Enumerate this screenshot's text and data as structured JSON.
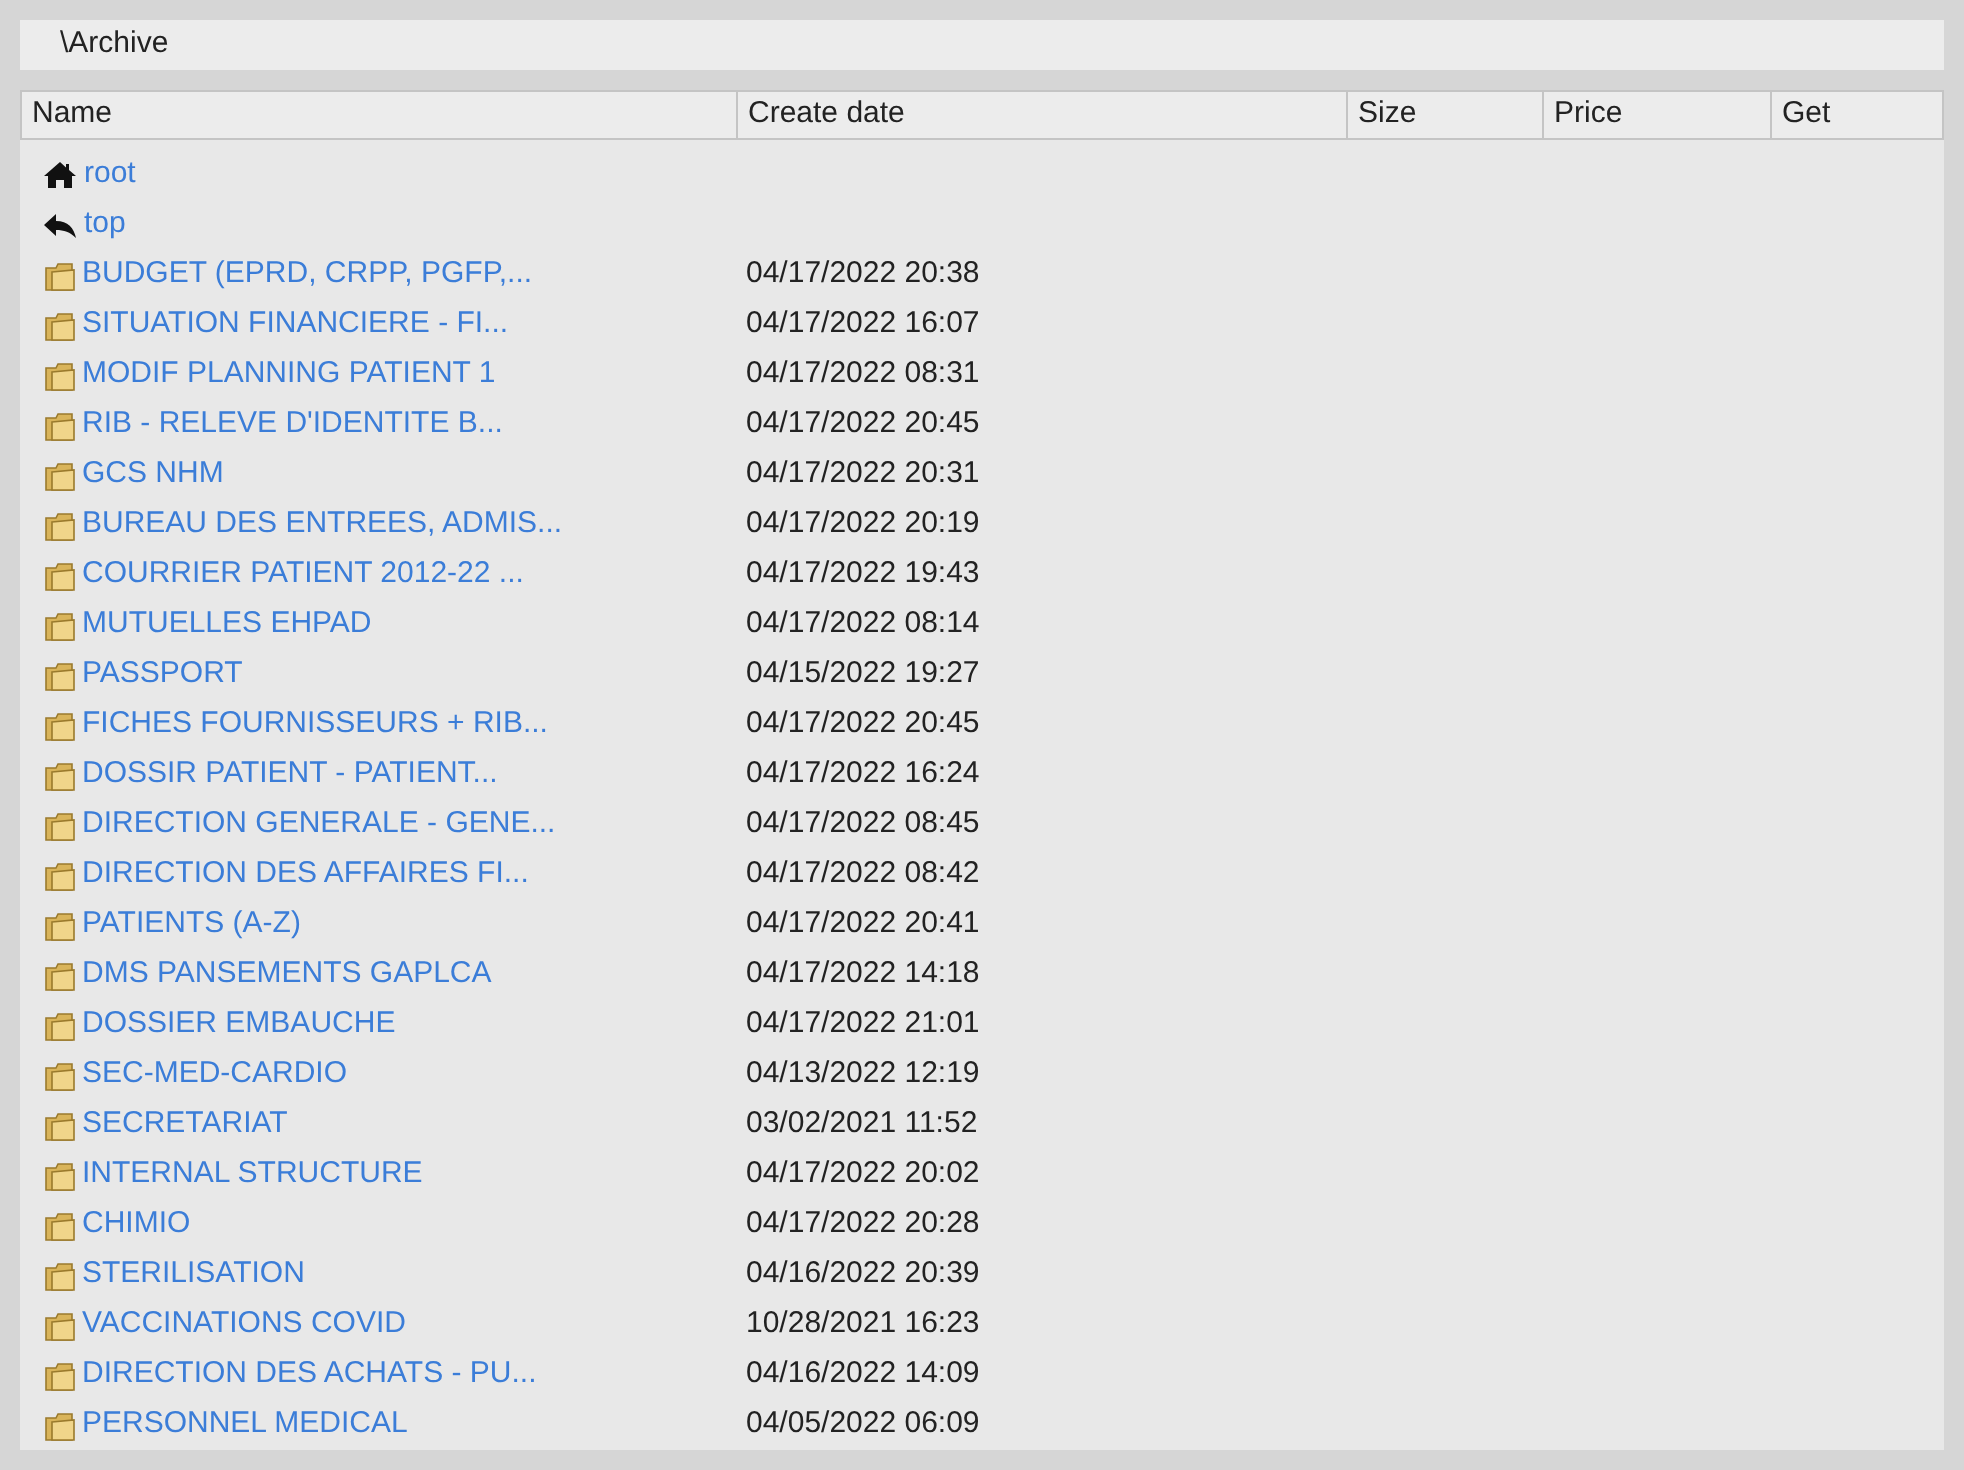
{
  "path": "\\Archive",
  "columns": [
    "Name",
    "Create date",
    "Size",
    "Price",
    "Get"
  ],
  "rows": [
    {
      "kind": "home",
      "name": "root"
    },
    {
      "kind": "up",
      "name": "top"
    },
    {
      "kind": "folder",
      "name": "BUDGET (EPRD, CRPP, PGFP,...",
      "date": "04/17/2022 20:38"
    },
    {
      "kind": "folder",
      "name": "SITUATION FINANCIERE - FI...",
      "date": "04/17/2022 16:07"
    },
    {
      "kind": "folder",
      "name": "MODIF PLANNING PATIENT 1",
      "date": "04/17/2022 08:31"
    },
    {
      "kind": "folder",
      "name": "RIB - RELEVE D'IDENTITE B...",
      "date": "04/17/2022 20:45"
    },
    {
      "kind": "folder",
      "name": "GCS NHM",
      "date": "04/17/2022 20:31"
    },
    {
      "kind": "folder",
      "name": "BUREAU DES ENTREES, ADMIS...",
      "date": "04/17/2022 20:19"
    },
    {
      "kind": "folder",
      "name": "COURRIER PATIENT 2012-22 ...",
      "date": "04/17/2022 19:43"
    },
    {
      "kind": "folder",
      "name": "MUTUELLES EHPAD",
      "date": "04/17/2022 08:14"
    },
    {
      "kind": "folder",
      "name": "PASSPORT",
      "date": "04/15/2022 19:27"
    },
    {
      "kind": "folder",
      "name": "FICHES FOURNISSEURS + RIB...",
      "date": "04/17/2022 20:45"
    },
    {
      "kind": "folder",
      "name": "DOSSIR PATIENT - PATIENT...",
      "date": "04/17/2022 16:24"
    },
    {
      "kind": "folder",
      "name": "DIRECTION GENERALE - GENE...",
      "date": "04/17/2022 08:45"
    },
    {
      "kind": "folder",
      "name": "DIRECTION DES AFFAIRES FI...",
      "date": "04/17/2022 08:42"
    },
    {
      "kind": "folder",
      "name": "PATIENTS (A-Z)",
      "date": "04/17/2022 20:41"
    },
    {
      "kind": "folder",
      "name": "DMS PANSEMENTS GAPLCA",
      "date": "04/17/2022 14:18"
    },
    {
      "kind": "folder",
      "name": "DOSSIER EMBAUCHE",
      "date": "04/17/2022 21:01"
    },
    {
      "kind": "folder",
      "name": "SEC-MED-CARDIO",
      "date": "04/13/2022 12:19"
    },
    {
      "kind": "folder",
      "name": "SECRETARIAT",
      "date": "03/02/2021 11:52"
    },
    {
      "kind": "folder",
      "name": "INTERNAL STRUCTURE",
      "date": "04/17/2022 20:02"
    },
    {
      "kind": "folder",
      "name": "CHIMIO",
      "date": "04/17/2022 20:28"
    },
    {
      "kind": "folder",
      "name": "STERILISATION",
      "date": "04/16/2022 20:39"
    },
    {
      "kind": "folder",
      "name": "VACCINATIONS COVID",
      "date": "10/28/2021 16:23"
    },
    {
      "kind": "folder",
      "name": "DIRECTION DES ACHATS - PU...",
      "date": "04/16/2022 14:09"
    },
    {
      "kind": "folder",
      "name": "PERSONNEL MEDICAL",
      "date": "04/05/2022 06:09"
    }
  ]
}
